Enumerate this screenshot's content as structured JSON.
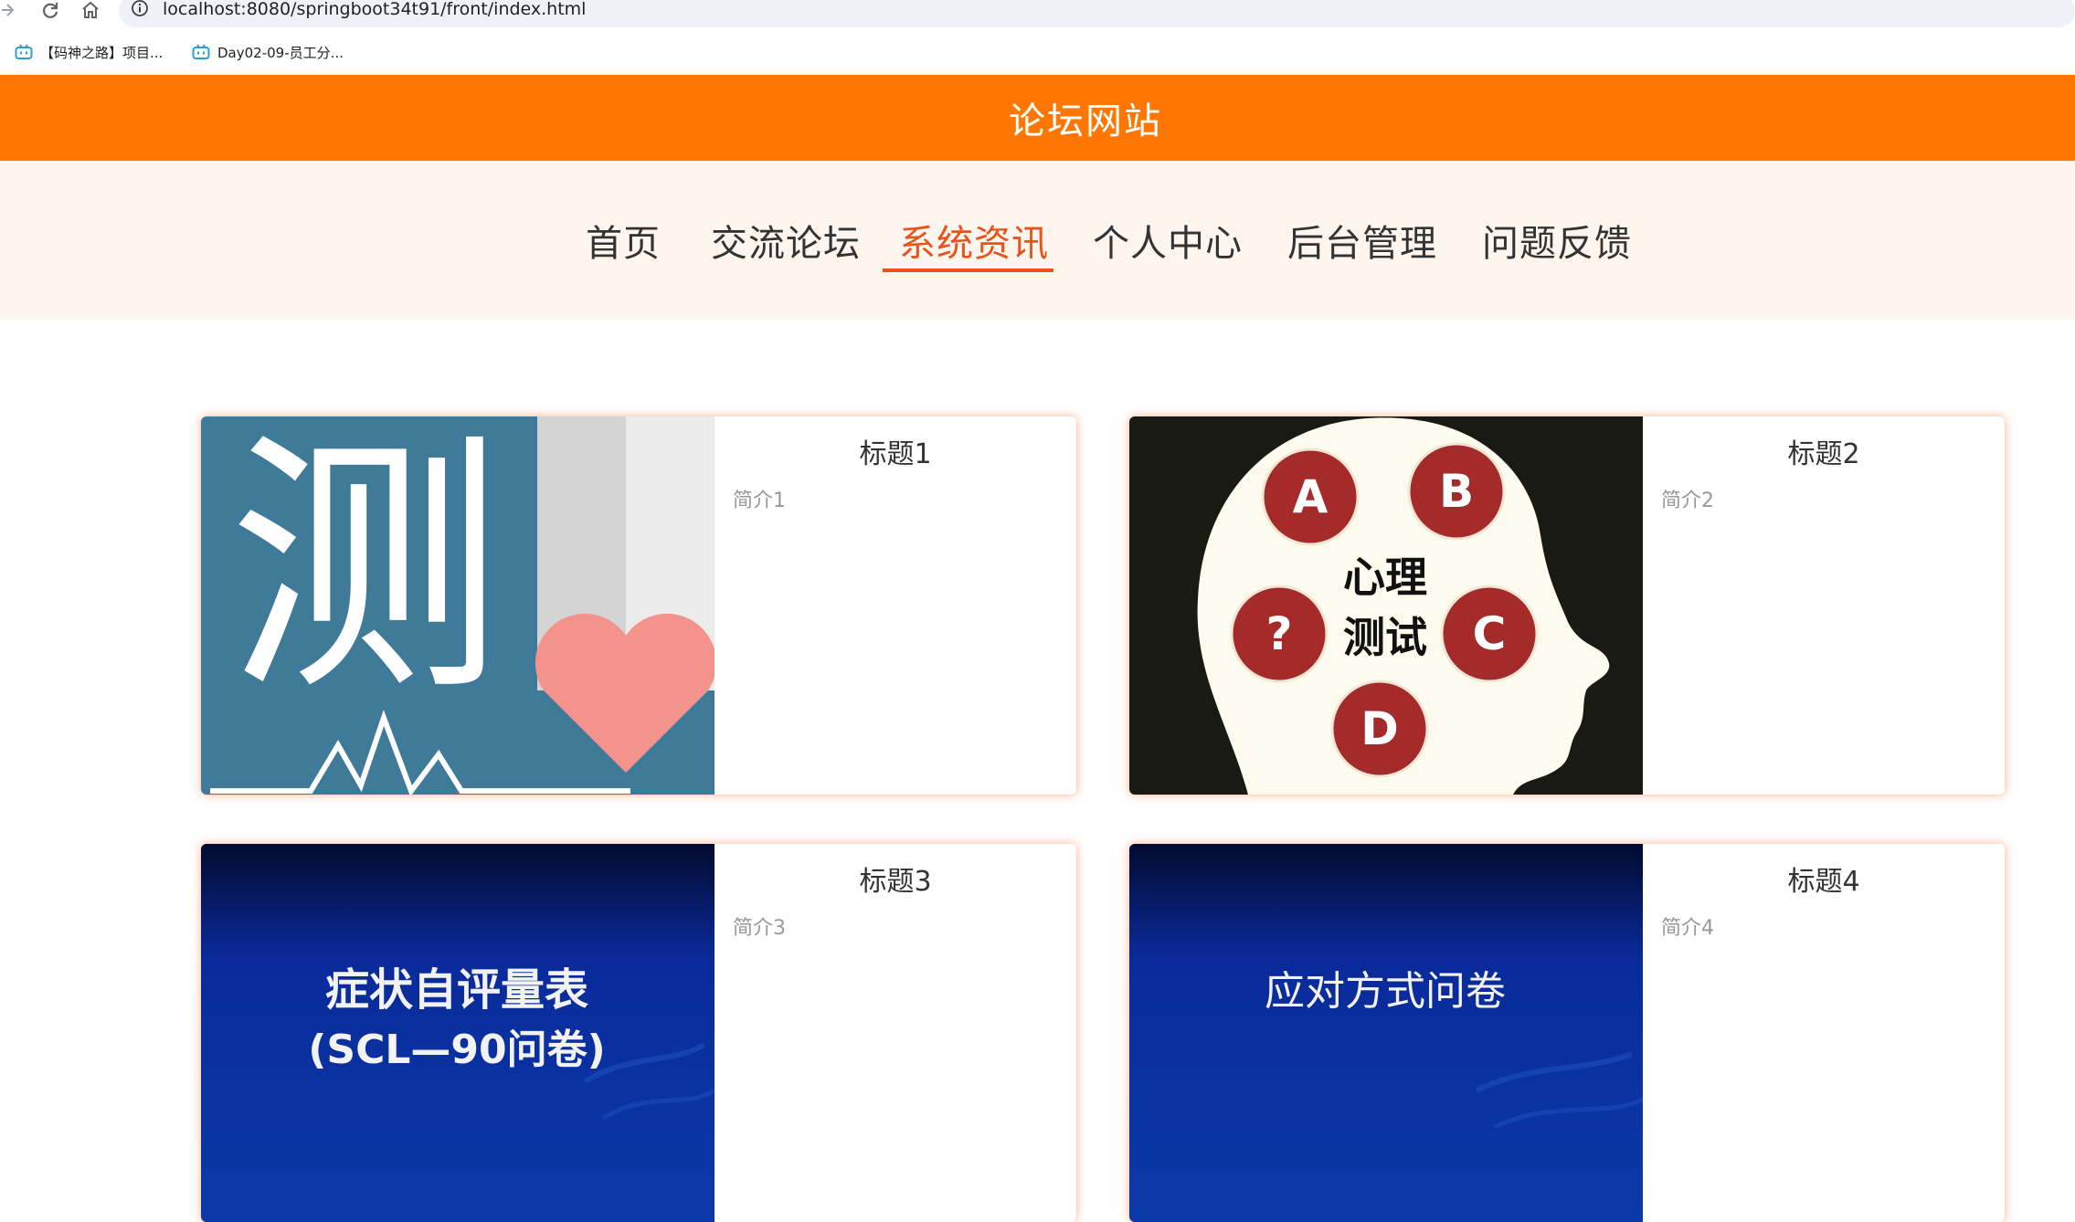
{
  "browser": {
    "url": "localhost:8080/springboot34t91/front/index.html",
    "bookmarks": [
      {
        "label": "【码神之路】项目..."
      },
      {
        "label": "Day02-09-员工分..."
      }
    ]
  },
  "site": {
    "title": "论坛网站"
  },
  "nav": {
    "items": [
      {
        "label": "首页"
      },
      {
        "label": "交流论坛"
      },
      {
        "label": "系统资讯"
      },
      {
        "label": "个人中心"
      },
      {
        "label": "后台管理"
      },
      {
        "label": "问题反馈"
      }
    ],
    "active_index": 2
  },
  "news": [
    {
      "title": "标题1",
      "summary": "简介1",
      "image_text": "测"
    },
    {
      "title": "标题2",
      "summary": "简介2",
      "image_text": [
        "A",
        "B",
        "?",
        "C",
        "D",
        "心理",
        "测试"
      ]
    },
    {
      "title": "标题3",
      "summary": "简介3",
      "image_text": [
        "症状自评量表",
        "(SCL—90问卷)"
      ]
    },
    {
      "title": "标题4",
      "summary": "简介4",
      "image_text": "应对方式问卷"
    }
  ],
  "colors": {
    "header": "#ff7600",
    "accent": "#e8531b",
    "nav_bg": "#fdf5ee"
  }
}
